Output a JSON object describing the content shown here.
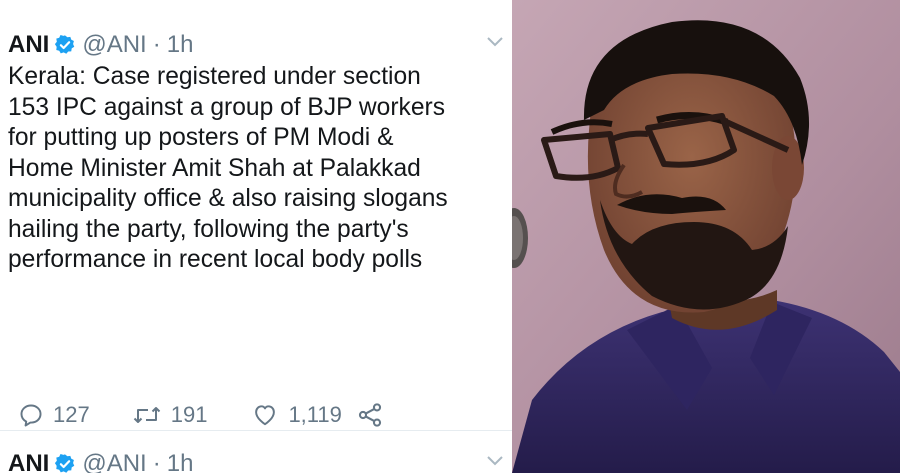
{
  "tweets": [
    {
      "author": "ANI",
      "handle": "@ANI",
      "separator": "·",
      "time": "1h",
      "text_lines": [
        "Kerala: Case registered under section",
        "153 IPC against a group of BJP workers",
        "for putting up posters of PM Modi &",
        "Home Minister Amit Shah at Palakkad",
        "municipality office & also raising slogans",
        "hailing the party, following the party's",
        "performance in recent local body polls"
      ],
      "actions": {
        "replies": "127",
        "retweets": "191",
        "likes": "1,119"
      }
    },
    {
      "author": "ANI",
      "handle": "@ANI",
      "separator": "·",
      "time": "1h"
    }
  ],
  "colors": {
    "text": "#14171a",
    "secondary": "#657786",
    "verified": "#1da1f2",
    "shirt": "#3a2f6b",
    "background_wall": "#b79aa9"
  },
  "icons": [
    "verified-badge-icon",
    "chevron-down-icon",
    "reply-icon",
    "retweet-icon",
    "like-icon",
    "share-icon",
    "microphone-icon"
  ]
}
